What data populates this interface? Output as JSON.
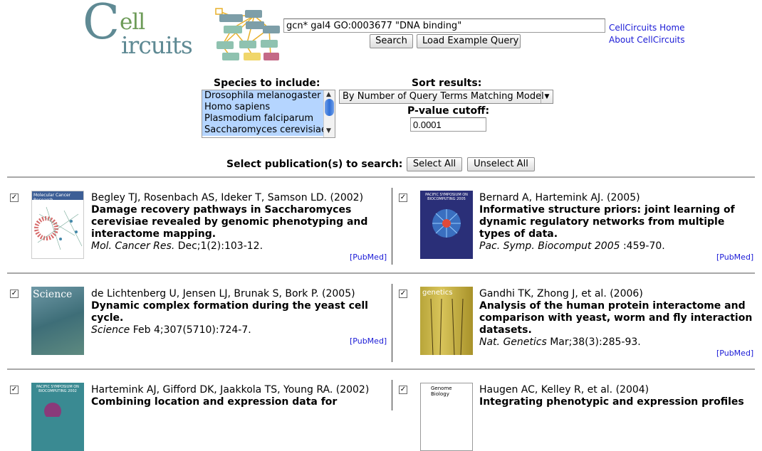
{
  "logo": {
    "line1": "ell",
    "line2": "ircuits",
    "initial": "C"
  },
  "search": {
    "query_value": "gcn* gal4 GO:0003677 \"DNA binding\"",
    "search_label": "Search",
    "example_label": "Load Example Query"
  },
  "links": {
    "home": "CellCircuits Home",
    "about": "About CellCircuits"
  },
  "species": {
    "label": "Species to include:",
    "options": [
      "Drosophila melanogaster",
      "Homo sapiens",
      "Plasmodium falciparum",
      "Saccharomyces cerevisiae"
    ]
  },
  "sort": {
    "label": "Sort results:",
    "selected": "By Number of Query Terms Matching Model"
  },
  "pvalue": {
    "label": "P-value cutoff:",
    "value": "0.0001"
  },
  "publications": {
    "label": "Select publication(s) to search:",
    "select_all": "Select All",
    "unselect_all": "Unselect All",
    "pubmed_label": "[PubMed]",
    "items": [
      {
        "authors": "Begley TJ, Rosenbach AS, Ideker T, Samson LD. (2002)",
        "title": "Damage recovery pathways in Saccharomyces cerevisiae revealed by genomic phenotyping and interactome mapping.",
        "journal": "Mol. Cancer Res.",
        "citation": " Dec;1(2):103-12.",
        "checked": true,
        "cover": "Molecular Cancer Research"
      },
      {
        "authors": "Bernard A, Hartemink AJ. (2005)",
        "title": "Informative structure priors: joint learning of dynamic regulatory networks from multiple types of data.",
        "journal": "Pac. Symp. Biocomput 2005",
        "citation": " :459-70.",
        "checked": true,
        "cover": "PACIFIC SYMPOSIUM ON BIOCOMPUTING 2005"
      },
      {
        "authors": "de Lichtenberg U, Jensen LJ, Brunak S, Bork P. (2005)",
        "title": "Dynamic complex formation during the yeast cell cycle.",
        "journal": "Science",
        "citation": " Feb 4;307(5710):724-7.",
        "checked": true,
        "cover": "Science"
      },
      {
        "authors": "Gandhi TK, Zhong J, et al. (2006)",
        "title": "Analysis of the human protein interactome and comparison with yeast, worm and fly interaction datasets.",
        "journal": "Nat. Genetics",
        "citation": " Mar;38(3):285-93.",
        "checked": true,
        "cover": "genetics"
      },
      {
        "authors": "Hartemink AJ, Gifford DK, Jaakkola TS, Young RA. (2002)",
        "title": "Combining location and expression data for",
        "journal": "",
        "citation": "",
        "checked": true,
        "cover": "PACIFIC SYMPOSIUM ON BIOCOMPUTING 2002"
      },
      {
        "authors": "Haugen AC, Kelley R, et al. (2004)",
        "title": "Integrating phenotypic and expression profiles",
        "journal": "",
        "citation": "",
        "checked": true,
        "cover": "Genome Biology"
      }
    ]
  },
  "colors": {
    "link": "#1a1ad6",
    "logo_teal": "#5f8a94",
    "logo_green": "#6d9b58",
    "selection": "#b5d5ff"
  }
}
